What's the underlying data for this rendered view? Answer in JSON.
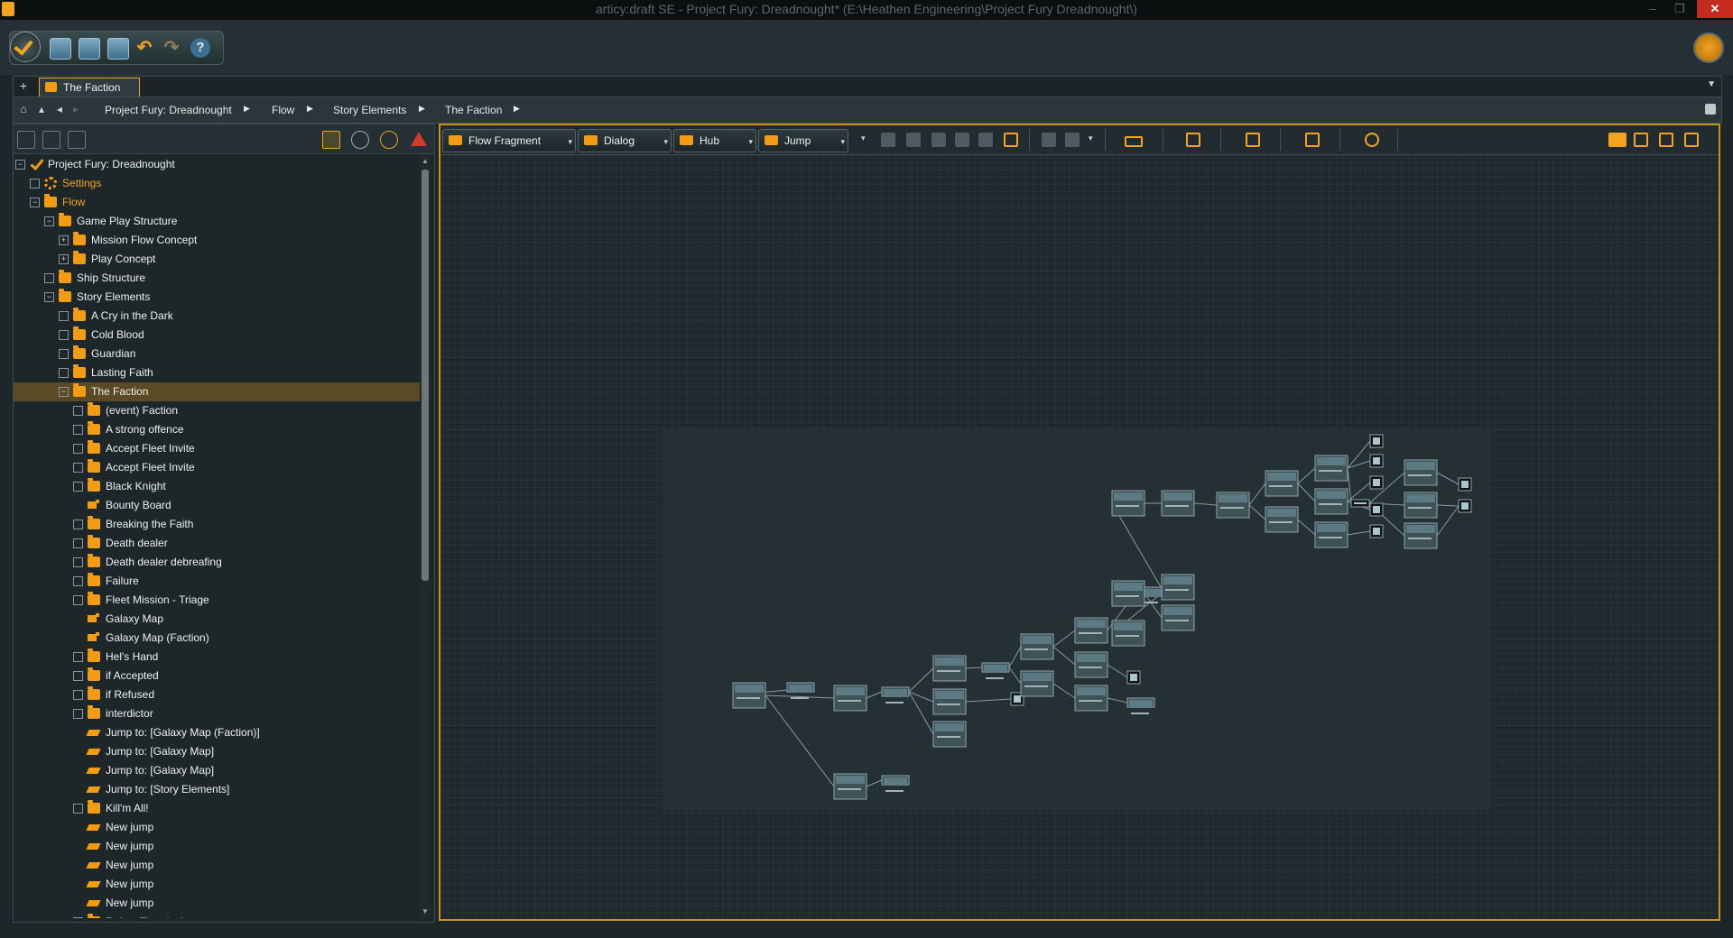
{
  "window": {
    "title": "articy:draft SE - Project Fury: Dreadnought* (E:\\Heathen Engineering\\Project Fury Dreadnought\\)",
    "close_label": "✕",
    "min_label": "–",
    "max_label": "❐"
  },
  "toolbar": {
    "icons": [
      "check-icon",
      "new-icon",
      "save-icon",
      "tools-icon",
      "undo-icon",
      "redo-icon",
      "help-icon",
      "academy-hat-icon"
    ],
    "help_label": "?"
  },
  "tabs": {
    "add_label": "+",
    "active": "The Faction",
    "menu_label": "▼"
  },
  "breadcrumb": [
    "Project Fury: Dreadnought",
    "Flow",
    "Story Elements",
    "The Faction"
  ],
  "tree": {
    "items": [
      {
        "label": "Project Fury: Dreadnought",
        "icon": "check",
        "exp": "−",
        "color": "white"
      },
      {
        "label": "Settings",
        "icon": "gear",
        "exp": "",
        "color": "orange"
      },
      {
        "label": "Flow",
        "icon": "folder",
        "exp": "−",
        "color": "orange"
      },
      {
        "label": "Game Play Structure",
        "icon": "folder",
        "exp": "−"
      },
      {
        "label": "Mission Flow Concept",
        "icon": "folder",
        "exp": "+"
      },
      {
        "label": "Play Concept",
        "icon": "folder",
        "exp": "+"
      },
      {
        "label": "Ship Structure",
        "icon": "folder",
        "exp": ""
      },
      {
        "label": "Story Elements",
        "icon": "folder",
        "exp": "−"
      },
      {
        "label": "A Cry in the Dark",
        "icon": "folder",
        "exp": ""
      },
      {
        "label": "Cold Blood",
        "icon": "folder",
        "exp": ""
      },
      {
        "label": "Guardian",
        "icon": "folder",
        "exp": ""
      },
      {
        "label": "Lasting Faith",
        "icon": "folder",
        "exp": ""
      },
      {
        "label": "The Faction",
        "icon": "folder",
        "exp": "−",
        "selected": true
      },
      {
        "label": "(event) Faction",
        "icon": "folder",
        "exp": ""
      },
      {
        "label": "A strong offence",
        "icon": "folder",
        "exp": ""
      },
      {
        "label": "Accept Fleet Invite",
        "icon": "folder",
        "exp": ""
      },
      {
        "label": "Accept Fleet Invite",
        "icon": "folder",
        "exp": ""
      },
      {
        "label": "Black Knight",
        "icon": "folder",
        "exp": ""
      },
      {
        "label": "Bounty Board",
        "icon": "hub",
        "exp": "none"
      },
      {
        "label": "Breaking the Faith",
        "icon": "folder",
        "exp": ""
      },
      {
        "label": "Death dealer",
        "icon": "folder",
        "exp": ""
      },
      {
        "label": "Death dealer debreafing",
        "icon": "folder",
        "exp": ""
      },
      {
        "label": "Failure",
        "icon": "folder",
        "exp": ""
      },
      {
        "label": "Fleet Mission - Triage",
        "icon": "folder",
        "exp": ""
      },
      {
        "label": "Galaxy Map",
        "icon": "hub",
        "exp": "none"
      },
      {
        "label": "Galaxy Map (Faction)",
        "icon": "hub",
        "exp": "none"
      },
      {
        "label": "Hel's Hand",
        "icon": "folder",
        "exp": ""
      },
      {
        "label": "if Accepted",
        "icon": "folder",
        "exp": ""
      },
      {
        "label": "if Refused",
        "icon": "folder",
        "exp": ""
      },
      {
        "label": "interdictor",
        "icon": "folder",
        "exp": ""
      },
      {
        "label": "Jump to: [Galaxy Map (Faction)]",
        "icon": "jump",
        "exp": "none"
      },
      {
        "label": "Jump to: [Galaxy Map]",
        "icon": "jump",
        "exp": "none"
      },
      {
        "label": "Jump to: [Galaxy Map]",
        "icon": "jump",
        "exp": "none"
      },
      {
        "label": "Jump to: [Story Elements]",
        "icon": "jump",
        "exp": "none"
      },
      {
        "label": "Kill'm All!",
        "icon": "folder",
        "exp": ""
      },
      {
        "label": "New jump",
        "icon": "jump",
        "exp": "none"
      },
      {
        "label": "New jump",
        "icon": "jump",
        "exp": "none"
      },
      {
        "label": "New jump",
        "icon": "jump",
        "exp": "none"
      },
      {
        "label": "New jump",
        "icon": "jump",
        "exp": "none"
      },
      {
        "label": "New jump",
        "icon": "jump",
        "exp": "none"
      },
      {
        "label": "Reject Fleet Invite",
        "icon": "folder",
        "exp": ""
      }
    ]
  },
  "flow_toolbar": {
    "buttons": [
      {
        "label": "Flow Fragment",
        "icon": "flow-fragment-icon"
      },
      {
        "label": "Dialog",
        "icon": "dialog-icon"
      },
      {
        "label": "Hub",
        "icon": "hub-icon"
      },
      {
        "label": "Jump",
        "icon": "jump-icon"
      }
    ],
    "dropdown_arrow": "▾"
  },
  "colors": {
    "accent": "#f3a41f",
    "folder": "#f39c12",
    "background": "#1d2629",
    "selection": "#5a4a25",
    "node": "#5c7a83",
    "close": "#c42b1c"
  }
}
